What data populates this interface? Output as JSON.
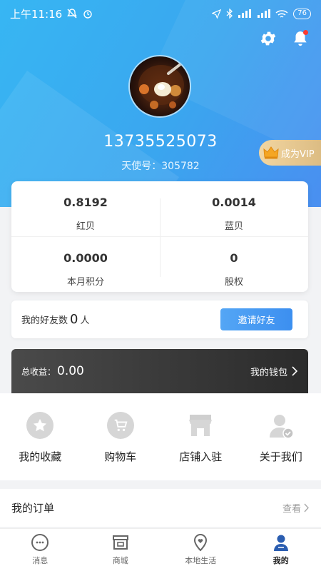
{
  "status_bar": {
    "time": "上午11:16",
    "battery": "76"
  },
  "profile": {
    "phone": "13735525073",
    "angel_id": "天使号：305782"
  },
  "vip": {
    "label": "成为VIP"
  },
  "stats": [
    {
      "value": "0.8192",
      "label": "红贝"
    },
    {
      "value": "0.0014",
      "label": "蓝贝"
    },
    {
      "value": "0.0000",
      "label": "本月积分"
    },
    {
      "value": "0",
      "label": "股权"
    }
  ],
  "friends": {
    "label": "我的好友数",
    "count": "0",
    "unit": "人",
    "invite_label": "邀请好友"
  },
  "wallet": {
    "income_label": "总收益：",
    "income_value": "0.00",
    "link_label": "我的钱包"
  },
  "menu": [
    {
      "label": "我的收藏",
      "icon": "star-icon"
    },
    {
      "label": "购物车",
      "icon": "cart-icon"
    },
    {
      "label": "店铺入驻",
      "icon": "shop-icon"
    },
    {
      "label": "关于我们",
      "icon": "user-check-icon"
    }
  ],
  "orders": {
    "title": "我的订单",
    "view_label": "查看"
  },
  "nav": [
    {
      "label": "消息",
      "icon": "message-icon"
    },
    {
      "label": "商城",
      "icon": "mall-icon"
    },
    {
      "label": "本地生活",
      "icon": "location-heart-icon"
    },
    {
      "label": "我的",
      "icon": "profile-icon",
      "active": true
    }
  ],
  "colors": {
    "brand_blue": "#3aa6ef",
    "vip_gold": "#dcbc83",
    "wallet_dark": "#2b2b2b"
  }
}
